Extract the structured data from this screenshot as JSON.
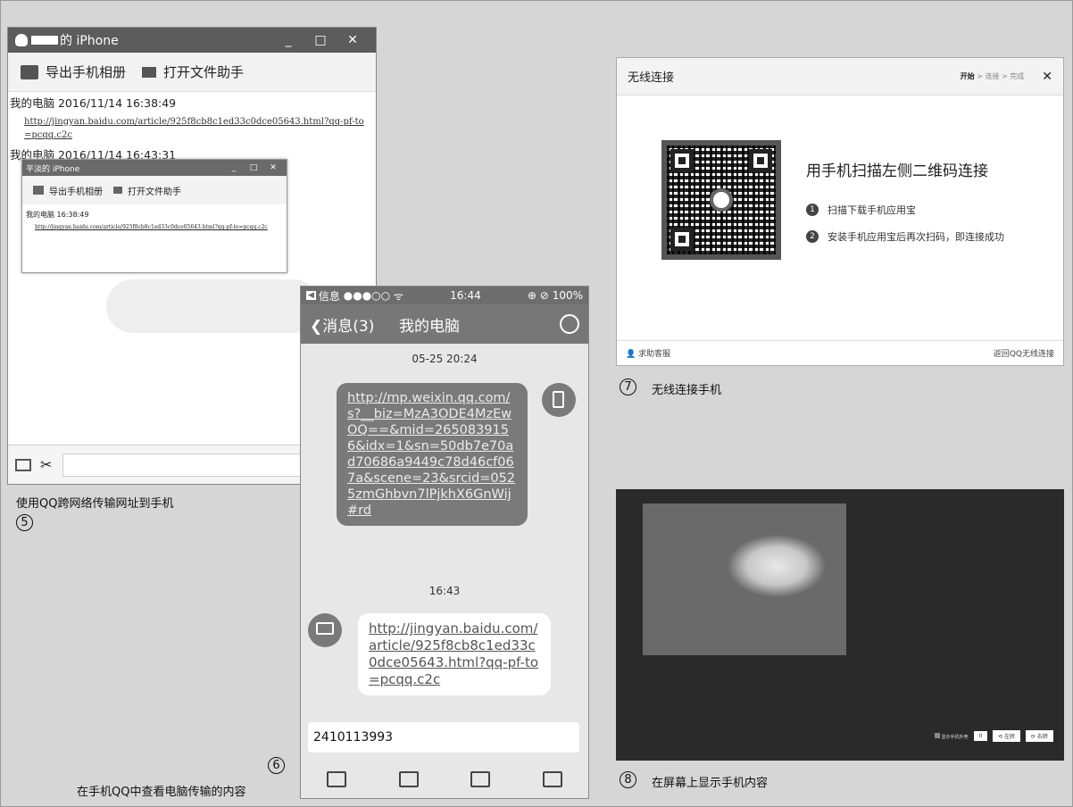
{
  "panel5": {
    "window_title_suffix": "的 iPhone",
    "controls": [
      "_",
      "□",
      "✕"
    ],
    "toolbar": {
      "export_album": "导出手机相册",
      "open_assistant": "打开文件助手"
    },
    "messages": [
      {
        "sender": "我的电脑 2016/11/14 16:38:49",
        "link": "http://jingyan.baidu.com/article/925f8cb8c1ed33c0dce05643.html?qq-pf-to=pcqq.c2c"
      },
      {
        "sender": "我的电脑 2016/11/14 16:43:31",
        "link": ""
      }
    ],
    "inner_window": {
      "title": "平淡的 iPhone",
      "controls": [
        "_",
        "□",
        "✕"
      ],
      "toolbar": {
        "export_album": "导出手机相册",
        "open_assistant": "打开文件助手"
      },
      "sender": "我的电脑 16:38:49",
      "link": "http://jingyan.baidu.com/article/925f8cb8c1ed33c0dce05643.html?qq-pf-to=pcqq.c2c"
    },
    "caption": "使用QQ跨网络传输网址到手机",
    "number": "5"
  },
  "panel6": {
    "status": {
      "back": "信息",
      "signal": "●●●○○",
      "wifi": "ᯤ",
      "time": "16:44",
      "icons": "⊕ ⊘",
      "battery": "100%"
    },
    "nav": {
      "back": "❮消息(3)",
      "title": "我的电脑"
    },
    "timestamp1": "05-25 20:24",
    "bubble_out": "http://mp.weixin.qq.com/s?__biz=MzA3ODE4MzEwOQ==&mid=2650839156&idx=1&sn=50db7e70ad70686a9449c78d46cf067a&scene=23&srcid=0525zmGhbvn7lPjkhX6GnWij#rd",
    "timestamp2": "16:43",
    "bubble_in": "http://jingyan.baidu.com/article/925f8cb8c1ed33c0dce05643.html?qq-pf-to=pcqq.c2c",
    "input_value": "2410113993",
    "caption": "在手机QQ中查看电脑传输的内容",
    "number": "6"
  },
  "panel7": {
    "title": "无线连接",
    "steps": {
      "start": "开始",
      "connect": "连接",
      "done": "完成"
    },
    "close": "✕",
    "heading": "用手机扫描左侧二维码连接",
    "step1": "扫描下载手机应用宝",
    "step2": "安装手机应用宝后再次扫码，即连接成功",
    "help": "求助客服",
    "back_link": "返回QQ无线连接",
    "caption": "无线连接手机",
    "number": "7"
  },
  "panel8": {
    "controls": {
      "show_frame": "显示手机外壳",
      "pause": "II",
      "rotate_left": "左转",
      "rotate_right": "右转"
    },
    "caption": "在屏幕上显示手机内容",
    "number": "8"
  }
}
